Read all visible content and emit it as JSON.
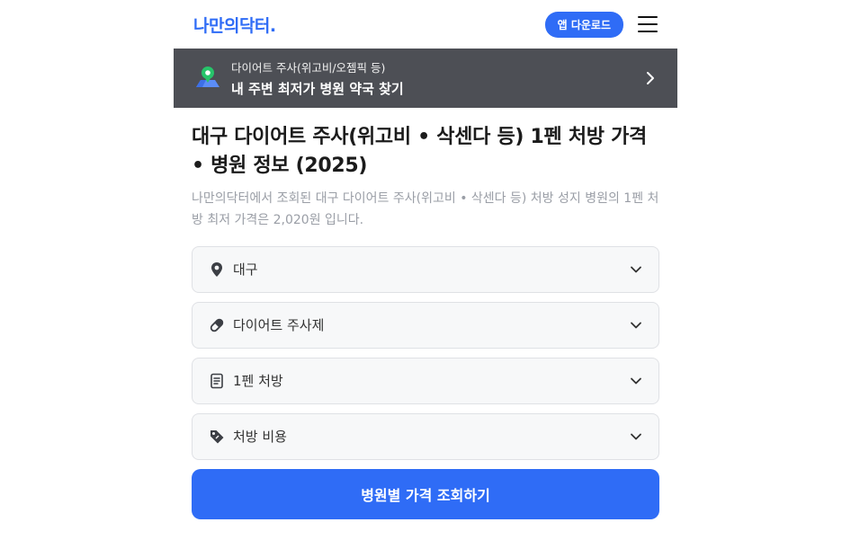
{
  "header": {
    "logo_text": "나만의닥터.",
    "app_download_label": "앱 다운로드",
    "menu_icon": "hamburger-menu-icon"
  },
  "banner": {
    "icon": "map-pin-icon",
    "subtitle": "다이어트 주사(위고비/오젬픽 등)",
    "title": "내 주변 최저가 병원 약국 찾기",
    "arrow_icon": "chevron-right-icon"
  },
  "main": {
    "title": "대구 다이어트 주사(위고비 • 삭센다 등) 1펜 처방 가격 • 병원 정보 (2025)",
    "description": "나만의닥터에서 조회된 대구 다이어트 주사(위고비 • 삭센다 등) 처방 성지 병원의 1펜 처방 최저 가격은 2,020원 입니다."
  },
  "filters": [
    {
      "label": "대구",
      "icon": "location-pin-icon"
    },
    {
      "label": "다이어트 주사제",
      "icon": "pill-icon"
    },
    {
      "label": "1펜 처방",
      "icon": "document-icon"
    },
    {
      "label": "처방 비용",
      "icon": "price-tag-icon"
    }
  ],
  "submit_label": "병원별 가격 조회하기",
  "colors": {
    "accent": "#2f6cf6",
    "banner_bg": "#4d4f55"
  }
}
